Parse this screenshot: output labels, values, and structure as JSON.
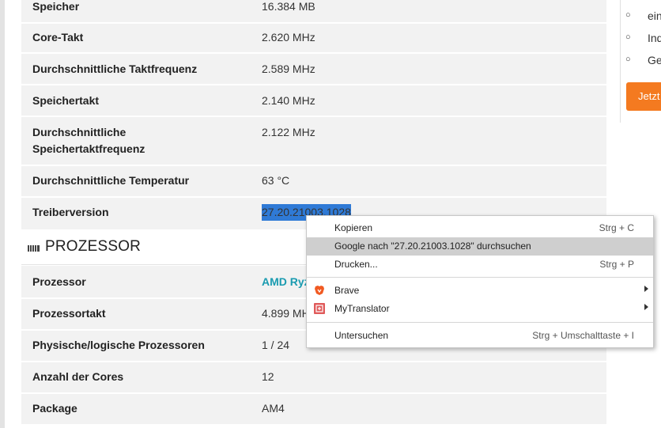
{
  "graphics_rows": [
    {
      "label": "Speicher",
      "value": "16.384 MB"
    },
    {
      "label": "Core-Takt",
      "value": "2.620 MHz"
    },
    {
      "label": "Durchschnittliche Taktfrequenz",
      "value": "2.589 MHz"
    },
    {
      "label": "Speichertakt",
      "value": "2.140 MHz"
    },
    {
      "label_line1": "Durchschnittliche",
      "label_line2": "Speichertaktfrequenz",
      "value": "2.122 MHz"
    },
    {
      "label": "Durchschnittliche Temperatur",
      "value": "63 °C"
    },
    {
      "label": "Treiberversion",
      "value": "27.20.21003.1028"
    }
  ],
  "processor_section": {
    "title": "PROZESSOR",
    "icon": "cpu-chip-icon",
    "rows": [
      {
        "label": "Prozessor",
        "value": "AMD Ryz"
      },
      {
        "label": "Prozessortakt",
        "value": "4.899 MH"
      },
      {
        "label": "Physische/logische Prozessoren",
        "value": "1 / 24"
      },
      {
        "label": "Anzahl der Cores",
        "value": "12"
      },
      {
        "label": "Package",
        "value": "AM4"
      }
    ]
  },
  "sidebar": {
    "bullets": [
      "ein",
      "Ind",
      "Ge"
    ],
    "cta_label": "Jetzt"
  },
  "context_menu": {
    "items": [
      {
        "label": "Kopieren",
        "shortcut": "Strg + C"
      },
      {
        "label": "Google nach \"27.20.21003.1028\" durchsuchen",
        "shortcut": ""
      },
      {
        "label": "Drucken...",
        "shortcut": "Strg + P"
      },
      {
        "label": "Brave",
        "icon": "brave-lion-icon"
      },
      {
        "label": "MyTranslator",
        "icon": "translator-icon"
      },
      {
        "label": "Untersuchen",
        "shortcut": "Strg + Umschalttaste + I"
      }
    ]
  },
  "colors": {
    "row_bg": "#f2f2f2",
    "link": "#1a9bb0",
    "selection": "#2f7ad6",
    "cta": "#f47a20",
    "menu_hover": "#cfcfcf"
  }
}
